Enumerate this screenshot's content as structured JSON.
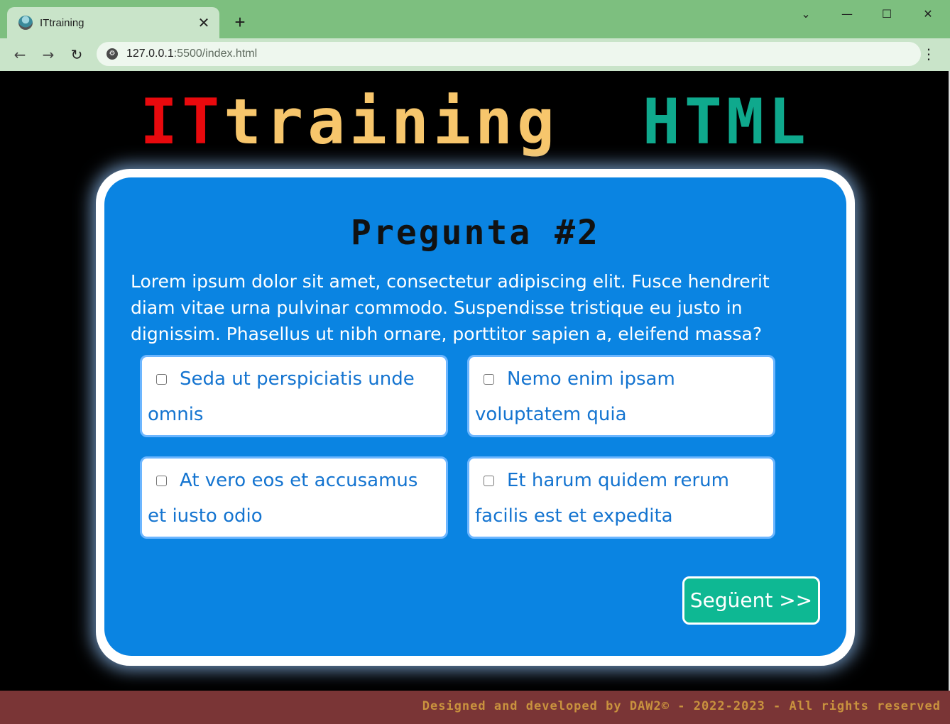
{
  "browser": {
    "tab_title": "ITtraining",
    "tab_close": "✕",
    "new_tab": "+",
    "url_host": "127.0.0.1",
    "url_rest": ":5500/index.html",
    "window_controls": {
      "dropdown": "⌄",
      "minimize": "—",
      "maximize": "☐",
      "close": "✕"
    },
    "nav": {
      "back": "←",
      "forward": "→",
      "reload": "↻"
    },
    "menu": "⋮"
  },
  "logo": {
    "part1": "IT",
    "part2": "training",
    "part3": "HTML",
    "colors": {
      "part1": "#e8090d",
      "part2": "#f7c66c",
      "part3": "#0fa98d"
    }
  },
  "question": {
    "title": "Pregunta #2",
    "text": "Lorem ipsum dolor sit amet, consectetur adipiscing elit. Fusce hendrerit diam vitae urna pulvinar commodo. Suspendisse tristique eu justo in dignissim. Phasellus ut nibh ornare, porttitor sapien a, eleifend massa?",
    "answers": [
      {
        "label": "Seda ut perspiciatis unde omnis",
        "checked": false
      },
      {
        "label": "Nemo enim ipsam voluptatem quia",
        "checked": false
      },
      {
        "label": "At vero eos et accusamus et iusto odio",
        "checked": false
      },
      {
        "label": "Et harum quidem rerum facilis est et expedita",
        "checked": false
      }
    ],
    "next_label": "Següent >>"
  },
  "footer": {
    "text": "Designed and developed by DAW2© - 2022-2023 - All rights reserved"
  },
  "colors": {
    "card_blue": "#0a84e2",
    "next_button": "#0eb893",
    "footer_bg": "#7a3536",
    "footer_text": "#c9923e",
    "chrome_green": "#7dbf7f"
  }
}
